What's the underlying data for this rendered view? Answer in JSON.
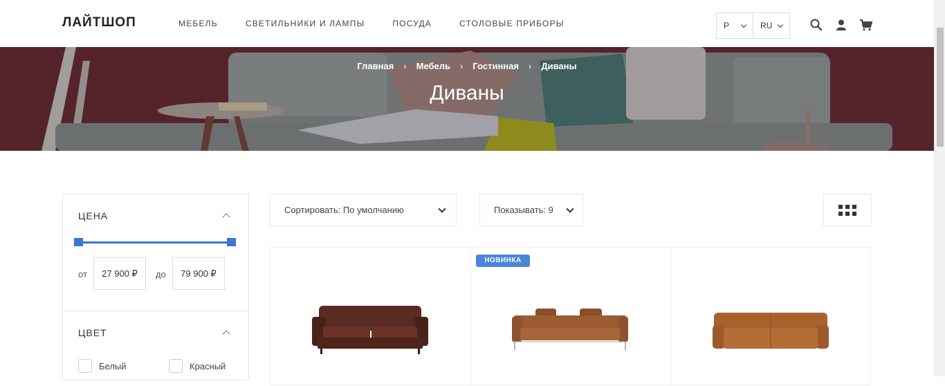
{
  "header": {
    "logo": "ЛАЙТШОП",
    "nav": [
      "МЕБЕЛЬ",
      "СВЕТИЛЬНИКИ И ЛАМПЫ",
      "ПОСУДА",
      "СТОЛОВЫЕ ПРИБОРЫ"
    ],
    "currency": "Р",
    "language": "RU",
    "icons": [
      "search-icon",
      "user-icon",
      "cart-icon"
    ]
  },
  "hero": {
    "breadcrumb": [
      "Главная",
      "Мебель",
      "Гостинная",
      "Диваны"
    ],
    "breadcrumb_separator": "›",
    "title": "Диваны"
  },
  "filter": {
    "price": {
      "title": "ЦЕНА",
      "from_label": "от",
      "from_value": "27 900 ₽",
      "to_label": "до",
      "to_value": "79 900 ₽"
    },
    "color": {
      "title": "ЦВЕТ",
      "options": [
        "Белый",
        "Красный"
      ]
    }
  },
  "toolbar": {
    "sort_label": "Сортировать: По умолчанию",
    "show_label": "Показывать: 9",
    "view_icon": "grid-view-icon"
  },
  "products": [
    {
      "badge": "",
      "image": "dark-brown-leather-sofa"
    },
    {
      "badge": "НОВИНКА",
      "image": "tan-leather-sofa-with-cushions"
    },
    {
      "badge": "",
      "image": "cognac-modular-leather-sofa"
    }
  ],
  "colors": {
    "accent": "#3a76d2",
    "badge": "#4a86d8",
    "hero_wall": "#6b2f36"
  }
}
